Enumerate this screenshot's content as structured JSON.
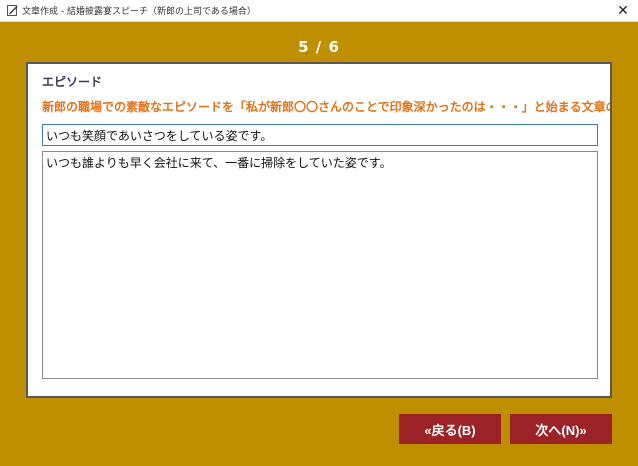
{
  "window": {
    "title": "文章作成 - 結婚披露宴スピーチ（新郎の上司である場合）"
  },
  "wizard": {
    "step": "5 / 6"
  },
  "panel": {
    "heading": "エピソード",
    "question": "新郎の職場での素敵なエピソードを「私が新郎〇〇さんのことで印象深かったのは・・・」と始まる文章の・",
    "summary_value": "いつも笑顔であいさつをしている姿です。",
    "body_value": "いつも誰よりも早く会社に来て、一番に掃除をしていた姿です。"
  },
  "buttons": {
    "back_label": "«戻る(B)",
    "next_label": "次へ(N)»"
  },
  "colors": {
    "frame": "#bf8f00",
    "button": "#9b2226",
    "question_text": "#e2731b"
  },
  "icons": {
    "app": "document-edit-icon",
    "close": "close-icon"
  }
}
